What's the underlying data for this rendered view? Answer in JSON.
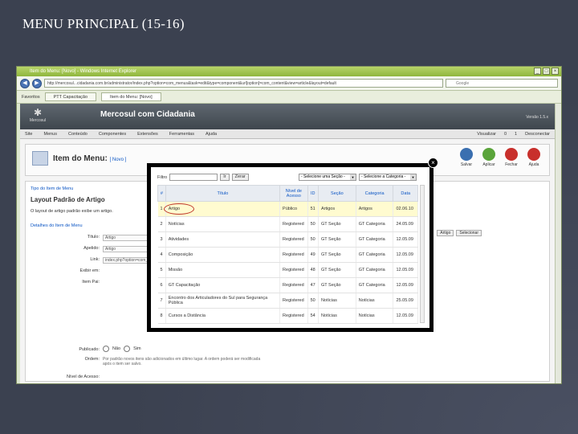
{
  "slide": {
    "title": "MENU PRINCIPAL (15-16)"
  },
  "browser": {
    "window_title": "Item do Menu: [Novo] - Windows Internet Explorer",
    "url": "http://mercosul...cidadania.com.br/administrator/index.php?option=com_menus&task=edit&type=component&url[option]=com_content&view=article&layout=default",
    "search_placeholder": "Google",
    "tabs": [
      "Favoritos",
      "PTT Capacitação",
      "Item do Menu: [Novo]"
    ]
  },
  "joomla": {
    "site_name": "Mercosul com Cidadania",
    "version": "Versão 1.5.x",
    "logo_text": "Mercosul",
    "menu": [
      "Site",
      "Menus",
      "Conteúdo",
      "Componentes",
      "Extensões",
      "Ferramentas",
      "Ajuda"
    ],
    "menu_right": [
      "Visualizar",
      "0",
      "1",
      "Desconectar"
    ],
    "toolbar_title": "Item do Menu:",
    "toolbar_sub": "[ Novo ]",
    "toolbar_buttons": [
      "Salvar",
      "Aplicar",
      "Fechar",
      "Ajuda"
    ],
    "crumb": "Tipo do Item de Menu",
    "layout_title": "Layout Padrão de Artigo",
    "layout_desc": "O layout de artigo padrão exibe um artigo.",
    "details_title": "Detalhes do Item de Menu",
    "fields": [
      {
        "label": "Título:",
        "value": "Artigo"
      },
      {
        "label": "Apelido:",
        "value": "Artigo"
      },
      {
        "label": "Link:",
        "value": "index.php?option=com_content"
      },
      {
        "label": "Exibir em:",
        "value": ""
      },
      {
        "label": "Item Pai:",
        "value": ""
      }
    ],
    "side_buttons": [
      "Artigo",
      "Selecionar"
    ],
    "published_label": "Publicado:",
    "published_no": "Não",
    "published_yes": "Sim",
    "order_label": "Ordem:",
    "order_text": "Por padrão novos itens são adicionados em último lugar. A ordem poderá ser modificada após o item ser salvo.",
    "access_label": "Nível de Acesso:"
  },
  "modal": {
    "filter_label": "Filtro",
    "go_label": "Ir",
    "reset_label": "Zerar",
    "section_select": "- Selecione uma Seção -",
    "category_select": "- Selecione a Categoria -",
    "headers": [
      "#",
      "Título",
      "Nível de Acesso",
      "ID",
      "Seção",
      "Categoria",
      "Data"
    ],
    "rows": [
      [
        "1",
        "Artigo",
        "Público",
        "51",
        "Artigos",
        "Artigos",
        "02.06.10"
      ],
      [
        "2",
        "Notícias",
        "Registered",
        "50",
        "GT Seção",
        "GT Categoria",
        "24.05.09"
      ],
      [
        "3",
        "Atividades",
        "Registered",
        "50",
        "GT Seção",
        "GT Categoria",
        "12.05.09"
      ],
      [
        "4",
        "Composição",
        "Registered",
        "49",
        "GT Seção",
        "GT Categoria",
        "12.05.09"
      ],
      [
        "5",
        "Missão",
        "Registered",
        "48",
        "GT Seção",
        "GT Categoria",
        "12.05.09"
      ],
      [
        "6",
        "GT Capacitação",
        "Registered",
        "47",
        "GT Seção",
        "GT Categoria",
        "12.05.09"
      ],
      [
        "7",
        "Encontro dos Articuladores do Sul para Segurança Pública",
        "Registered",
        "50",
        "Notícias",
        "Notícias",
        "25.05.09"
      ],
      [
        "8",
        "Cursos a Distância",
        "Registered",
        "54",
        "Notícias",
        "Notícias",
        "12.05.09"
      ]
    ]
  }
}
